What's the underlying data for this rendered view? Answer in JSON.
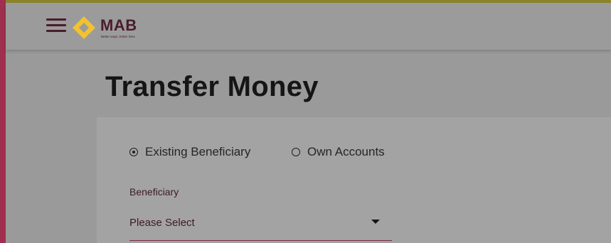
{
  "app": {
    "brand": "MAB",
    "tagline": "Better ways, better lives",
    "colors": {
      "accent": "#9e2f4f",
      "brand": "#4a1d2c",
      "logo": "#f2c230"
    }
  },
  "header": {
    "menu_icon": "hamburger-icon",
    "logo_icon": "diamond-logo"
  },
  "page": {
    "title": "Transfer Money"
  },
  "transfer_form": {
    "transfer_type": {
      "options": [
        {
          "label": "Existing Beneficiary",
          "selected": true
        },
        {
          "label": "Own Accounts",
          "selected": false
        }
      ]
    },
    "beneficiary": {
      "label": "Beneficiary",
      "placeholder": "Please Select",
      "icon": "caret-down-icon"
    }
  }
}
